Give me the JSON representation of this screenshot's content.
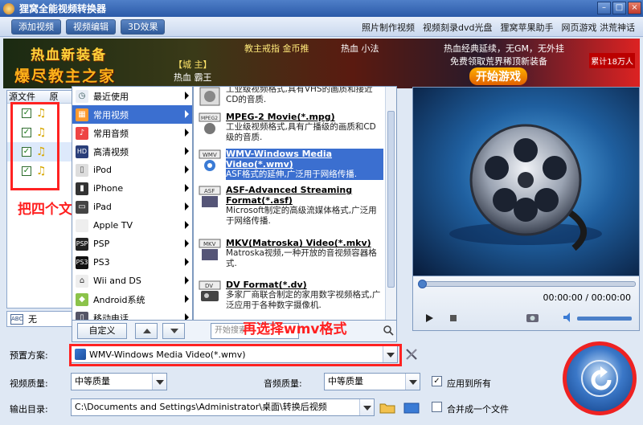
{
  "window": {
    "title": "狸窝全能视频转换器"
  },
  "toolbar": {
    "buttons": [
      "添加视频",
      "视频编辑",
      "3D效果"
    ],
    "links": [
      "照片制作视频",
      "视频刻录dvd光盘",
      "狸窝苹果助手",
      "网页游戏 洪荒神话"
    ]
  },
  "banner": {
    "line1": "热血新装备",
    "line2": "爆尽教主之家",
    "tag1": "【城 主】",
    "tag2": "热血 霸王",
    "tag3": "教主戒指  金币推",
    "tag4": "热血 小法",
    "tag5": "热血经典延续，无GM，无外挂",
    "tag6": "免费领取荒界稀顶新装备",
    "play_button": "开始游戏",
    "right_badge": "累计18万人"
  },
  "file_list": {
    "header": "源文件",
    "header2": "原",
    "rows": 4,
    "subtitle_value": "无"
  },
  "left_menu": {
    "items": [
      {
        "label": "最近使用",
        "icon": "clock-icon"
      },
      {
        "label": "常用视频",
        "icon": "film-icon",
        "selected": true
      },
      {
        "label": "常用音频",
        "icon": "music-icon"
      },
      {
        "label": "高清视频",
        "icon": "hd-icon"
      },
      {
        "label": "iPod",
        "icon": "ipod-icon"
      },
      {
        "label": "iPhone",
        "icon": "iphone-icon"
      },
      {
        "label": "iPad",
        "icon": "ipad-icon"
      },
      {
        "label": "Apple TV",
        "icon": "apple-icon"
      },
      {
        "label": "PSP",
        "icon": "psp-icon"
      },
      {
        "label": "PS3",
        "icon": "ps3-icon"
      },
      {
        "label": "Wii and DS",
        "icon": "wii-icon"
      },
      {
        "label": "Android系统",
        "icon": "android-icon"
      },
      {
        "label": "移动电话",
        "icon": "phone-icon"
      }
    ]
  },
  "right_menu": {
    "items": [
      {
        "title": "",
        "desc": "工业级视频格式,具有VHS的画质和接近CD的音质.",
        "icon": "mpeg1-icon"
      },
      {
        "title": "MPEG-2 Movie(*.mpg)",
        "desc": "工业级视频格式,具有广播级的画质和CD级的音质.",
        "icon": "mpeg2-icon"
      },
      {
        "title": "WMV-Windows Media Video(*.wmv)",
        "desc": "ASF格式的延伸,广泛用于网络传播.",
        "icon": "wmv-icon",
        "selected": true
      },
      {
        "title": "ASF-Advanced Streaming Format(*.asf)",
        "desc": "Microsoft制定的高级流媒体格式,广泛用于网络传播.",
        "icon": "asf-icon"
      },
      {
        "title": "MKV(Matroska) Video(*.mkv)",
        "desc": "Matroska视频,一种开放的音视频容器格式.",
        "icon": "mkv-icon"
      },
      {
        "title": "DV Format(*.dv)",
        "desc": "多家厂商联合制定的家用数字视频格式,广泛应用于各种数字摄像机.",
        "icon": "dv-icon"
      }
    ]
  },
  "menu_bottom": {
    "custom_label": "自定义",
    "search_placeholder": "开始搜索"
  },
  "annotations": {
    "check_all": "把四个文件都打上勾",
    "choose_wmv": "再选择wmv格式"
  },
  "settings": {
    "preset_label": "预置方案:",
    "preset_value": "WMV-Windows Media Video(*.wmv)",
    "video_quality_label": "视频质量:",
    "video_quality_value": "中等质量",
    "audio_quality_label": "音频质量:",
    "audio_quality_value": "中等质量",
    "apply_all_label": "应用到所有",
    "output_label": "输出目录:",
    "output_value": "C:\\Documents and Settings\\Administrator\\桌面\\转换后视频",
    "merge_label": "合并成一个文件"
  },
  "player": {
    "time": "00:00:00 / 00:00:00"
  }
}
